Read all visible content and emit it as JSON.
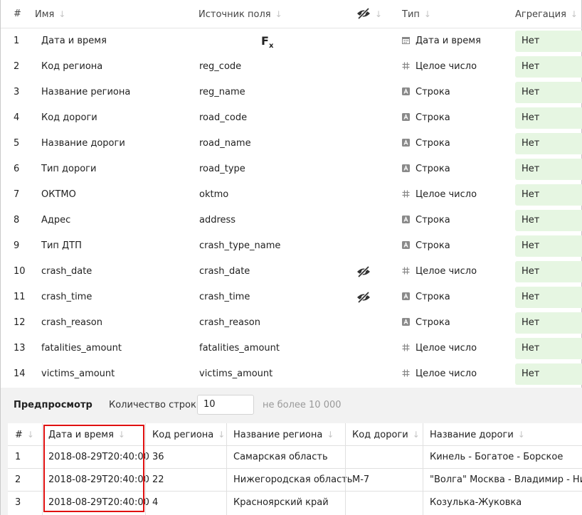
{
  "fields_table": {
    "columns": [
      "#",
      "Имя",
      "Источник поля",
      "Тип",
      "Агрегация"
    ],
    "hidden_column_icon": "eye-slash-icon",
    "rows": [
      {
        "num": "1",
        "name": "Дата и время",
        "source": "",
        "source_icon": "formula-icon",
        "formula_label": "F",
        "formula_sub": "x",
        "hidden": false,
        "type": "Дата и время",
        "type_icon": "calendar-icon",
        "agg": "Нет"
      },
      {
        "num": "2",
        "name": "Код региона",
        "source": "reg_code",
        "hidden": false,
        "type": "Целое число",
        "type_icon": "hash-icon",
        "agg": "Нет"
      },
      {
        "num": "3",
        "name": "Название региона",
        "source": "reg_name",
        "hidden": false,
        "type": "Строка",
        "type_icon": "string-icon",
        "agg": "Нет"
      },
      {
        "num": "4",
        "name": "Код дороги",
        "source": "road_code",
        "hidden": false,
        "type": "Строка",
        "type_icon": "string-icon",
        "agg": "Нет"
      },
      {
        "num": "5",
        "name": "Название дороги",
        "source": "road_name",
        "hidden": false,
        "type": "Строка",
        "type_icon": "string-icon",
        "agg": "Нет"
      },
      {
        "num": "6",
        "name": "Тип дороги",
        "source": "road_type",
        "hidden": false,
        "type": "Строка",
        "type_icon": "string-icon",
        "agg": "Нет"
      },
      {
        "num": "7",
        "name": "ОКТМО",
        "source": "oktmo",
        "hidden": false,
        "type": "Целое число",
        "type_icon": "hash-icon",
        "agg": "Нет"
      },
      {
        "num": "8",
        "name": "Адрес",
        "source": "address",
        "hidden": false,
        "type": "Строка",
        "type_icon": "string-icon",
        "agg": "Нет"
      },
      {
        "num": "9",
        "name": "Тип ДТП",
        "source": "crash_type_name",
        "hidden": false,
        "type": "Строка",
        "type_icon": "string-icon",
        "agg": "Нет"
      },
      {
        "num": "10",
        "name": "crash_date",
        "source": "crash_date",
        "hidden": true,
        "type": "Целое число",
        "type_icon": "hash-icon",
        "agg": "Нет"
      },
      {
        "num": "11",
        "name": "crash_time",
        "source": "crash_time",
        "hidden": true,
        "type": "Строка",
        "type_icon": "string-icon",
        "agg": "Нет"
      },
      {
        "num": "12",
        "name": "crash_reason",
        "source": "crash_reason",
        "hidden": false,
        "type": "Строка",
        "type_icon": "string-icon",
        "agg": "Нет"
      },
      {
        "num": "13",
        "name": "fatalities_amount",
        "source": "fatalities_amount",
        "hidden": false,
        "type": "Целое число",
        "type_icon": "hash-icon",
        "agg": "Нет"
      },
      {
        "num": "14",
        "name": "victims_amount",
        "source": "victims_amount",
        "hidden": false,
        "type": "Целое число",
        "type_icon": "hash-icon",
        "agg": "Нет"
      }
    ]
  },
  "preview": {
    "title": "Предпросмотр",
    "rows_label": "Количество строк:",
    "rows_value": "10",
    "rows_hint": "не более 10 000",
    "columns": [
      "#",
      "Дата и время",
      "Код региона",
      "Название региона",
      "Код дороги",
      "Название дороги"
    ],
    "rows": [
      [
        "1",
        "2018-08-29T20:40:00",
        "36",
        "Самарская область",
        "",
        "Кинель - Богатое - Борское"
      ],
      [
        "2",
        "2018-08-29T20:40:00",
        "22",
        "Нижегородская область",
        "М-7",
        "\"Волга\" Москва - Владимир - Нижний Новгород"
      ],
      [
        "3",
        "2018-08-29T20:40:00",
        "4",
        "Красноярский край",
        "",
        "Козулька-Жуковка"
      ]
    ]
  },
  "colors": {
    "aggregation_bg": "#e6f6e2",
    "highlight_border": "#e01010",
    "preview_bg": "#f2f2f2"
  }
}
